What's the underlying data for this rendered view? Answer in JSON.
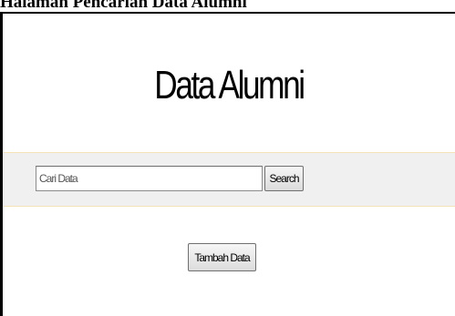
{
  "caption": "Halaman Pencarian Data  Alumni",
  "page": {
    "title": "Data Alumni"
  },
  "search": {
    "placeholder": "Cari Data",
    "button_label": "Search"
  },
  "actions": {
    "add_label": "Tambah Data"
  },
  "colors": {
    "search_band_bg": "#f0f0f0",
    "search_band_border": "#f4e3b8",
    "frame_border": "#000000"
  }
}
